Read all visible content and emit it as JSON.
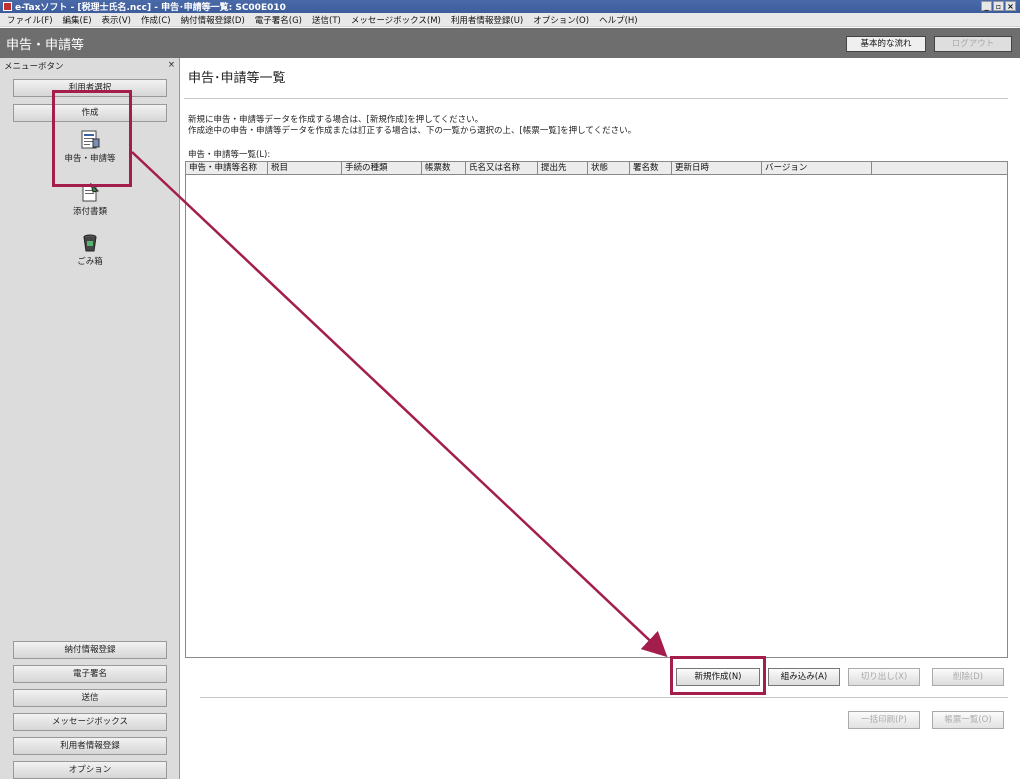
{
  "window": {
    "title": "e-Taxソフト - [税理士氏名.ncc] - 申告･申請等一覧: SC00E010",
    "buttons": [
      "_",
      "▫",
      "×"
    ]
  },
  "menubar": [
    "ファイル(F)",
    "編集(E)",
    "表示(V)",
    "作成(C)",
    "納付情報登録(D)",
    "電子署名(G)",
    "送信(T)",
    "メッセージボックス(M)",
    "利用者情報登録(U)",
    "オプション(O)",
    "ヘルプ(H)"
  ],
  "header": {
    "title": "申告・申請等",
    "flow_button": "基本的な流れ",
    "logout_button": "ログアウト"
  },
  "sidebar": {
    "header": "メニューボタン",
    "close": "×",
    "top_tab": "利用者選択",
    "create_tab": "作成",
    "icons": [
      "申告・申請等",
      "添付書類",
      "ごみ箱"
    ],
    "bottom_tabs": [
      "納付情報登録",
      "電子署名",
      "送信",
      "メッセージボックス",
      "利用者情報登録",
      "オプション"
    ]
  },
  "main": {
    "title": "申告･申請等一覧",
    "desc_line1": "新規に申告・申請等データを作成する場合は、[新規作成]を押してください。",
    "desc_line2": "作成途中の申告・申請等データを作成または訂正する場合は、下の一覧から選択の上、[帳票一覧]を押してください。",
    "list_label": "申告・申請等一覧(L):",
    "columns": [
      "申告・申請等名称",
      "税目",
      "手続の種類",
      "帳票数",
      "氏名又は名称",
      "提出先",
      "状態",
      "署名数",
      "更新日時",
      "バージョン",
      ""
    ],
    "buttons_row1": [
      "新規作成(N)",
      "組み込み(A)",
      "切り出し(X)",
      "削除(D)"
    ],
    "buttons_row2": [
      "一括印刷(P)",
      "帳票一覧(O)"
    ]
  },
  "highlight_color": "#a31d4d"
}
